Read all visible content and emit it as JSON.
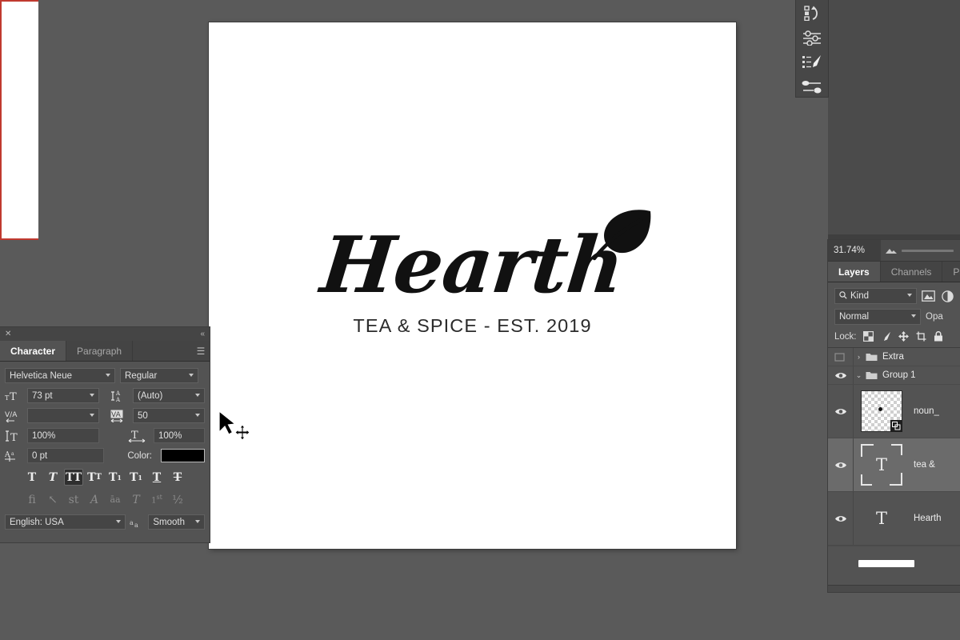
{
  "document": {
    "logo": {
      "wordmark": "Hearth",
      "tagline": "TEA & SPICE - EST. 2019",
      "leaf_icon": "leaf-icon",
      "ink_color": "#111111"
    }
  },
  "cursor": {
    "icon": "move-tool-cursor"
  },
  "mini_toolbar": {
    "buttons": [
      {
        "label": "",
        "icon": "history-icon"
      },
      {
        "label": "",
        "icon": "adjustments-sliders-icon"
      },
      {
        "label": "",
        "icon": "brush-settings-icon"
      },
      {
        "label": "",
        "icon": "brush-presets-icon"
      }
    ]
  },
  "character_panel": {
    "close_label": "✕",
    "collapse_label": "«",
    "menu_label": "☰",
    "tabs": [
      {
        "label": "Character",
        "active": true
      },
      {
        "label": "Paragraph",
        "active": false
      }
    ],
    "font_family": "Helvetica Neue",
    "font_style": "Regular",
    "font_size": "73 pt",
    "leading": "(Auto)",
    "kerning": "",
    "tracking": "50",
    "vertical_scale": "100%",
    "horizontal_scale": "100%",
    "baseline_shift": "0 pt",
    "color_label": "Color:",
    "color_value": "#000000",
    "icons": {
      "font_size": "font-size-icon",
      "leading": "leading-icon",
      "kerning": "kerning-icon",
      "tracking": "tracking-icon",
      "vertical_scale": "vertical-scale-icon",
      "horizontal_scale": "horizontal-scale-icon",
      "baseline_shift": "baseline-shift-icon"
    },
    "style_buttons": [
      {
        "label": "T",
        "name": "faux-bold",
        "state": "off",
        "render": "bold"
      },
      {
        "label": "T",
        "name": "faux-italic",
        "state": "off",
        "render": "italic"
      },
      {
        "label": "TT",
        "name": "all-caps",
        "state": "on",
        "render": "caps"
      },
      {
        "label": "TT",
        "name": "small-caps",
        "state": "off",
        "render": "smallcaps"
      },
      {
        "label": "T",
        "name": "superscript",
        "state": "off",
        "render": "sup"
      },
      {
        "label": "T",
        "name": "subscript",
        "state": "off",
        "render": "sub"
      },
      {
        "label": "T",
        "name": "underline",
        "state": "off",
        "render": "underline"
      },
      {
        "label": "T",
        "name": "strikethrough",
        "state": "off",
        "render": "strike"
      }
    ],
    "opentype_buttons": [
      {
        "label": "fi",
        "name": "standard-ligatures"
      },
      {
        "label": "℘",
        "name": "contextual-alternates"
      },
      {
        "label": "st",
        "name": "discretionary-ligatures"
      },
      {
        "label": "ᵍ0",
        "name": "swash"
      },
      {
        "label": "aa",
        "name": "oldstyle"
      },
      {
        "label": "T",
        "name": "titling-alternates"
      },
      {
        "label": "1st",
        "name": "ordinals"
      },
      {
        "label": "½",
        "name": "fractions"
      }
    ],
    "language": "English: USA",
    "antialias_icon": "anti-aliasing-icon",
    "antialias": "Smooth"
  },
  "right_dock": {
    "status": {
      "zoom": "31.74%",
      "doc_icon": "document-size-icon"
    },
    "tabs": [
      {
        "label": "Layers",
        "active": true
      },
      {
        "label": "Channels",
        "active": false
      },
      {
        "label": "Paths",
        "active": false
      }
    ],
    "filter": {
      "kind_label": "Kind",
      "search_icon": "search-icon",
      "pixel_filter_icon": "image-filter-icon",
      "adjustment_filter_icon": "adjustment-filter-icon"
    },
    "blend_mode": "Normal",
    "opacity_label": "Opa",
    "lock": {
      "label": "Lock:",
      "items": [
        {
          "name": "lock-transparent-pixels-icon"
        },
        {
          "name": "lock-image-pixels-icon"
        },
        {
          "name": "lock-position-icon"
        },
        {
          "name": "lock-artboard-nesting-icon"
        },
        {
          "name": "lock-all-icon"
        }
      ]
    },
    "layers": [
      {
        "name": "Extra",
        "type": "group",
        "visible": false,
        "expanded": false,
        "selected": false,
        "disclosure": "›"
      },
      {
        "name": "Group 1",
        "type": "group",
        "visible": true,
        "expanded": true,
        "selected": false,
        "disclosure": "⌄"
      },
      {
        "name": "noun_",
        "type": "smart-object",
        "visible": true,
        "selected": false,
        "thumbnail": "transparent-checker-thumbnail"
      },
      {
        "name": "tea & ",
        "type": "text",
        "visible": true,
        "selected": true,
        "thumbnail": "text-layer-thumbnail"
      },
      {
        "name": "Hearth",
        "type": "text",
        "visible": true,
        "selected": false,
        "thumbnail": "text-layer-thumbnail"
      }
    ]
  }
}
